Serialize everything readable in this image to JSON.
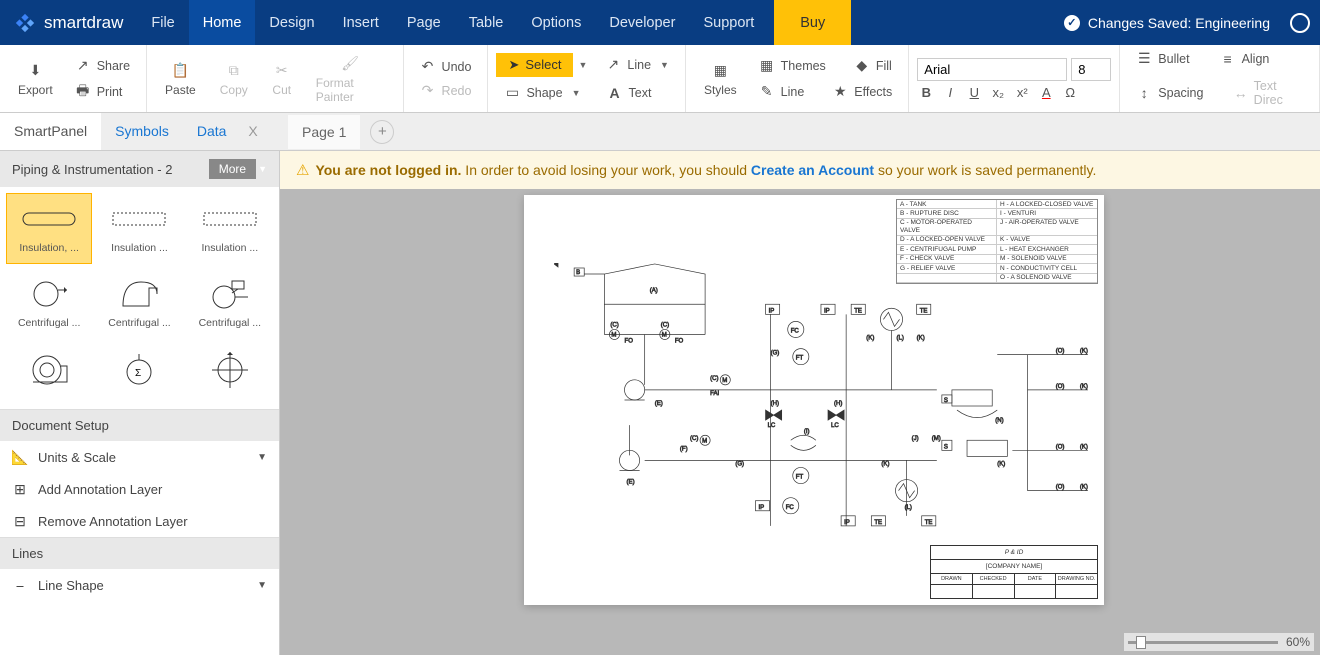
{
  "app": {
    "name": "smartdraw",
    "status": "Changes Saved: Engineering"
  },
  "menus": [
    "File",
    "Home",
    "Design",
    "Insert",
    "Page",
    "Table",
    "Options",
    "Developer",
    "Support"
  ],
  "active_menu": "Home",
  "buy": "Buy",
  "ribbon": {
    "export": "Export",
    "share": "Share",
    "print": "Print",
    "paste": "Paste",
    "copy": "Copy",
    "cut": "Cut",
    "format_painter": "Format Painter",
    "undo": "Undo",
    "redo": "Redo",
    "select": "Select",
    "shape": "Shape",
    "line": "Line",
    "text": "Text",
    "styles": "Styles",
    "themes": "Themes",
    "fill": "Fill",
    "line2": "Line",
    "effects": "Effects",
    "font": "Arial",
    "size": "8",
    "bullet": "Bullet",
    "align": "Align",
    "spacing": "Spacing",
    "textdir": "Text Direc"
  },
  "smartpanel": {
    "title": "SmartPanel",
    "tabs": {
      "symbols": "Symbols",
      "data": "Data",
      "close": "X"
    },
    "library": "Piping & Instrumentation - 2",
    "more": "More",
    "symbols": [
      {
        "label": "Insulation, ..."
      },
      {
        "label": "Insulation ..."
      },
      {
        "label": "Insulation ..."
      },
      {
        "label": "Centrifugal ..."
      },
      {
        "label": "Centrifugal ..."
      },
      {
        "label": "Centrifugal ..."
      },
      {
        "label": ""
      },
      {
        "label": ""
      },
      {
        "label": ""
      }
    ],
    "doc_setup": "Document Setup",
    "units": "Units & Scale",
    "add_layer": "Add Annotation Layer",
    "remove_layer": "Remove Annotation Layer",
    "lines": "Lines",
    "line_shape": "Line Shape"
  },
  "pages": {
    "page1": "Page 1"
  },
  "banner": {
    "lead": "You are not logged in.",
    "mid": " In order to avoid losing your work, you should ",
    "link": "Create an Account",
    "tail": " so your work is saved permanently."
  },
  "legend": [
    [
      "A - TANK",
      "H - A LOCKED-CLOSED VALVE"
    ],
    [
      "B - RUPTURE DISC",
      "I - VENTURI"
    ],
    [
      "C - MOTOR-OPERATED VALVE",
      "J - AIR-OPERATED VALVE"
    ],
    [
      "D - A LOCKED-OPEN VALVE",
      "K - VALVE"
    ],
    [
      "E - CENTRIFUGAL PUMP",
      "L - HEAT EXCHANGER"
    ],
    [
      "F - CHECK VALVE",
      "M - SOLENOID VALVE"
    ],
    [
      "G - RELIEF VALVE",
      "N - CONDUCTIVITY CELL"
    ],
    [
      "",
      "O - A SOLENOID VALVE"
    ]
  ],
  "titleblock": {
    "title": "P & ID",
    "company": "[COMPANY NAME]",
    "cols": [
      "DRAWN",
      "CHECKED",
      "DATE",
      "DRAWING NO."
    ]
  },
  "zoom": "60%"
}
